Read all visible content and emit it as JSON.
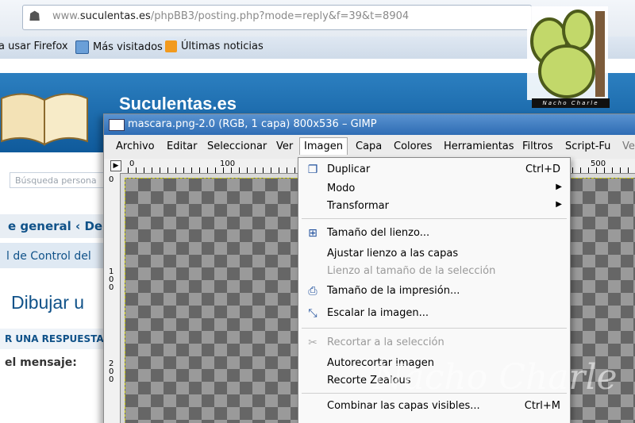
{
  "browser": {
    "url_prefix": "www.",
    "url_domain": "suculentas.es",
    "url_path": "/phpBB3/posting.php?mode=reply&f=39&t=8904",
    "bookmarks": [
      "a usar Firefox",
      "Más visitados",
      "Últimas noticias"
    ]
  },
  "site": {
    "title": "Suculentas.es",
    "search_placeholder": "Búsqueda persona",
    "breadcrumb": "e general ‹ De",
    "control_panel": "l de Control del",
    "heading": "Dibujar u",
    "post_reply": "R UNA RESPUESTA",
    "message_label": "el mensaje:",
    "logo_text": "Nacho Charle"
  },
  "gimp": {
    "title": "mascara.png-2.0 (RGB, 1 capa) 800x536 – GIMP",
    "menu": [
      "Archivo",
      "Editar",
      "Seleccionar",
      "Ver",
      "Imagen",
      "Capa",
      "Colores",
      "Herramientas",
      "Filtros",
      "Script-Fu",
      "Ve"
    ],
    "ruler_labels": [
      "0",
      "100",
      "500"
    ],
    "vruler_labels": [
      "1\n0\n0",
      "2\n0\n0"
    ]
  },
  "imagen_menu": [
    {
      "label": "Duplicar",
      "shortcut": "Ctrl+D",
      "icon": "duplicate-icon",
      "enabled": true
    },
    {
      "label": "Modo",
      "submenu": true,
      "enabled": true
    },
    {
      "label": "Transformar",
      "submenu": true,
      "enabled": true
    },
    {
      "label": "Tamaño del lienzo...",
      "icon": "canvas-size-icon",
      "enabled": true
    },
    {
      "label": "Ajustar lienzo a las capas",
      "enabled": true
    },
    {
      "label": "Lienzo al tamaño de la selección",
      "enabled": false
    },
    {
      "label": "Tamaño de la impresión...",
      "icon": "print-size-icon",
      "enabled": true
    },
    {
      "label": "Escalar la imagen...",
      "icon": "scale-image-icon",
      "enabled": true
    },
    {
      "label": "Recortar a la selección",
      "icon": "crop-icon",
      "enabled": false
    },
    {
      "label": "Autorecortar imagen",
      "enabled": true
    },
    {
      "label": "Recorte Zealous",
      "enabled": true
    },
    {
      "label": "Combinar las capas visibles...",
      "shortcut": "Ctrl+M",
      "enabled": true
    }
  ],
  "watermark": "Nacho Charle"
}
